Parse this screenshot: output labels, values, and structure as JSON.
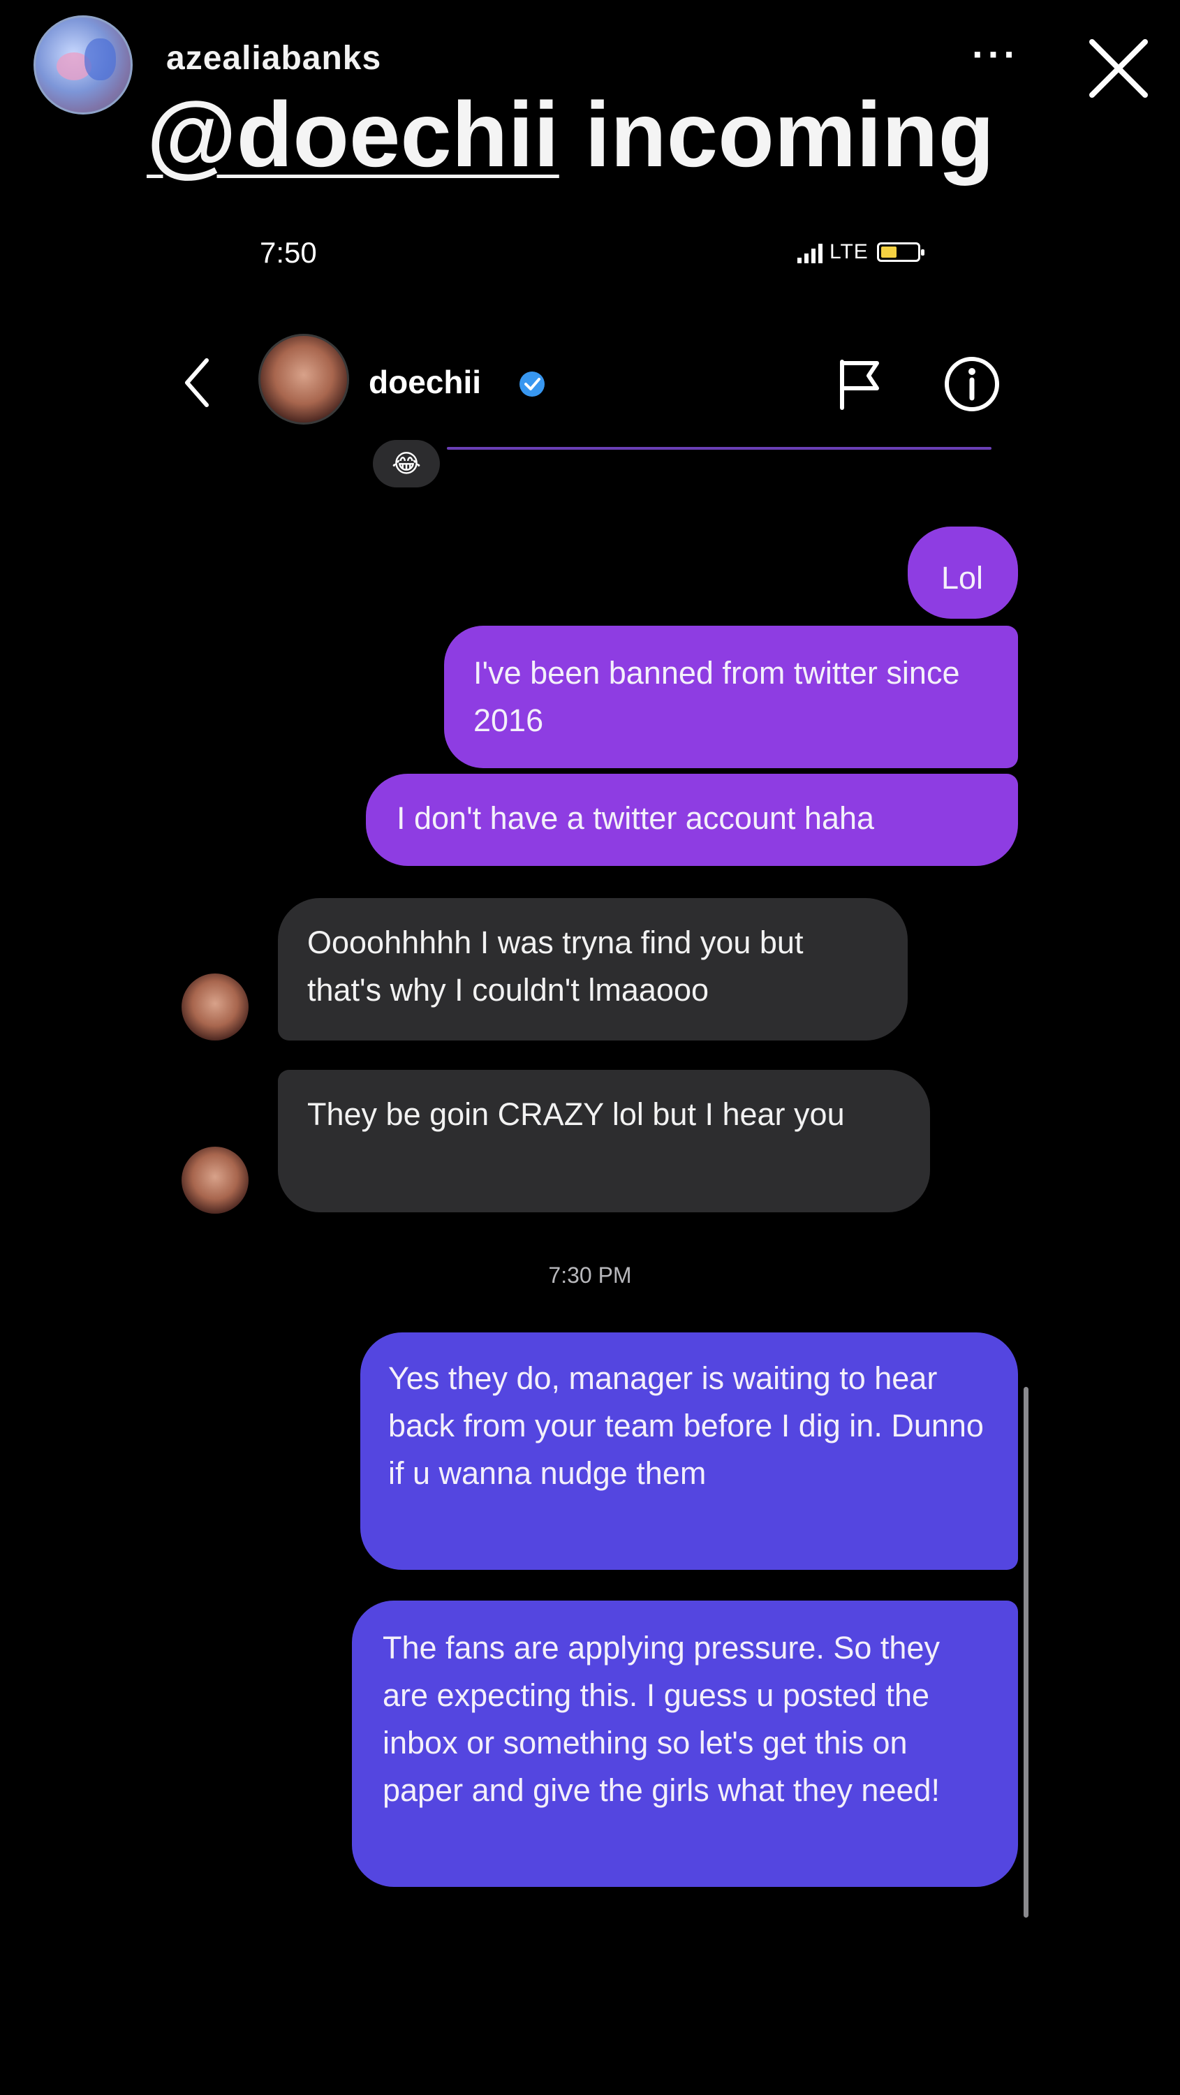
{
  "story": {
    "username": "azealiabanks",
    "more_label": "···",
    "caption_mention": "@doechii",
    "caption_text": " incoming"
  },
  "status_bar": {
    "time": "7:50",
    "network": "LTE"
  },
  "chat": {
    "contact_name": "doechii",
    "reaction_emoji": "😂",
    "timestamp": "7:30 PM",
    "messages": [
      {
        "side": "outgoing",
        "text": "Lol"
      },
      {
        "side": "outgoing",
        "text": "I've been banned from twitter since 2016"
      },
      {
        "side": "outgoing",
        "text": "I don't have a twitter account haha"
      },
      {
        "side": "incoming",
        "text": "Oooohhhhh I was tryna find you but that's why I couldn't lmaaooo"
      },
      {
        "side": "incoming",
        "text": "They be goin CRAZY lol but I hear you"
      },
      {
        "side": "outgoing",
        "text": "Yes they do, manager is waiting to hear back from your team before I dig in. Dunno if u wanna nudge them"
      },
      {
        "side": "outgoing",
        "text": "The fans are applying pressure. So they are expecting this. I guess u posted the inbox or something so let's get this on paper and give the girls what they need!"
      }
    ]
  },
  "colors": {
    "outgoing_purple": "#8e3de2",
    "outgoing_blue": "#5446e0",
    "incoming_gray": "#2d2d2f",
    "verified_blue": "#3897f0",
    "battery_yellow": "#f5d142"
  }
}
